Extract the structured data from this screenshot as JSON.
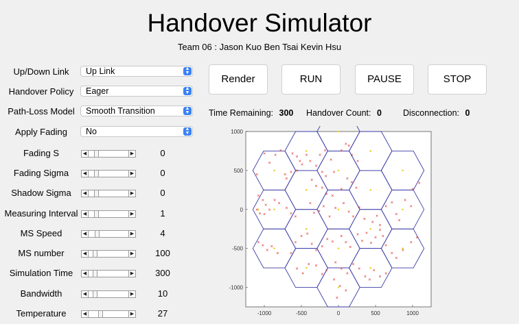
{
  "app": {
    "title": "Handover Simulator",
    "team": "Team 06 :  Jason Kuo  Ben Tsai  Kevin Hsu"
  },
  "controls": {
    "dropdowns": [
      {
        "label": "Up/Down Link",
        "value": "Up Link"
      },
      {
        "label": "Handover Policy",
        "value": "Eager"
      },
      {
        "label": "Path-Loss Model",
        "value": "Smooth Transition"
      },
      {
        "label": "Apply Fading",
        "value": "No"
      }
    ],
    "sliders": [
      {
        "label": "Fading S",
        "value": "0",
        "level": 0.15
      },
      {
        "label": "Fading Sigma",
        "value": "0",
        "level": 0.15
      },
      {
        "label": "Shadow Sigma",
        "value": "0",
        "level": 0.15
      },
      {
        "label": "Measuring Interval",
        "value": "1",
        "level": 0.15
      },
      {
        "label": "MS Speed",
        "value": "4",
        "level": 0.18
      },
      {
        "label": "MS number",
        "value": "100",
        "level": 0.12
      },
      {
        "label": "Simulation Time",
        "value": "300",
        "level": 0.12
      },
      {
        "label": "Bandwidth",
        "value": "10",
        "level": 0.12
      },
      {
        "label": "Temperature",
        "value": "27",
        "level": 0.28
      }
    ]
  },
  "buttons": {
    "render": "Render",
    "run": "RUN",
    "pause": "PAUSE",
    "stop": "STOP"
  },
  "status": {
    "time_label": "Time Remaining:",
    "time_value": "300",
    "handover_label": "Handover Count:",
    "handover_value": "0",
    "disconnect_label": "Disconnection:",
    "disconnect_value": "0"
  },
  "chart_data": {
    "type": "scatter",
    "title": "",
    "xlabel": "",
    "ylabel": "",
    "xlim": [
      -1250,
      1250
    ],
    "ylim": [
      -1250,
      1000
    ],
    "xticks": [
      -1000,
      -500,
      0,
      500,
      1000
    ],
    "yticks": [
      1000,
      500,
      0,
      -500,
      -1000
    ],
    "hex_cells_centers": [
      [
        0,
        0
      ],
      [
        0,
        500
      ],
      [
        433,
        250
      ],
      [
        433,
        -250
      ],
      [
        0,
        -500
      ],
      [
        -433,
        -250
      ],
      [
        -433,
        250
      ],
      [
        0,
        1000
      ],
      [
        433,
        750
      ],
      [
        866,
        500
      ],
      [
        866,
        0
      ],
      [
        866,
        -500
      ],
      [
        433,
        -750
      ],
      [
        0,
        -1000
      ],
      [
        -433,
        -750
      ],
      [
        -866,
        -500
      ],
      [
        -866,
        0
      ],
      [
        -866,
        500
      ],
      [
        -433,
        750
      ]
    ],
    "hex_radius": 289,
    "series": [
      {
        "color": "#dd2222",
        "marker": "x",
        "points": [
          [
            -1100,
            450
          ],
          [
            -1000,
            720
          ],
          [
            -930,
            600
          ],
          [
            -850,
            700
          ],
          [
            -780,
            760
          ],
          [
            -620,
            720
          ],
          [
            -560,
            680
          ],
          [
            -520,
            620
          ],
          [
            -490,
            580
          ],
          [
            -430,
            700
          ],
          [
            -560,
            500
          ],
          [
            -640,
            480
          ],
          [
            -720,
            450
          ],
          [
            -700,
            400
          ],
          [
            -380,
            620
          ],
          [
            -300,
            560
          ],
          [
            -250,
            700
          ],
          [
            -180,
            760
          ],
          [
            -100,
            640
          ],
          [
            -60,
            480
          ],
          [
            40,
            760
          ],
          [
            100,
            840
          ],
          [
            140,
            820
          ],
          [
            180,
            700
          ],
          [
            260,
            620
          ],
          [
            -220,
            480
          ],
          [
            -170,
            430
          ],
          [
            -360,
            380
          ],
          [
            -300,
            300
          ],
          [
            -220,
            280
          ],
          [
            -160,
            200
          ],
          [
            -80,
            180
          ],
          [
            40,
            260
          ],
          [
            120,
            400
          ],
          [
            180,
            350
          ],
          [
            240,
            280
          ],
          [
            -1080,
            180
          ],
          [
            -1020,
            120
          ],
          [
            -980,
            60
          ],
          [
            -930,
            0
          ],
          [
            -1060,
            -50
          ],
          [
            -1100,
            0
          ],
          [
            -1000,
            -60
          ],
          [
            -860,
            120
          ],
          [
            -800,
            80
          ],
          [
            -700,
            20
          ],
          [
            -640,
            -50
          ],
          [
            -580,
            -90
          ],
          [
            -380,
            80
          ],
          [
            -330,
            -40
          ],
          [
            -260,
            -20
          ],
          [
            -200,
            40
          ],
          [
            -120,
            -90
          ],
          [
            -40,
            20
          ],
          [
            70,
            80
          ],
          [
            140,
            -30
          ],
          [
            200,
            -90
          ],
          [
            280,
            30
          ],
          [
            350,
            -120
          ],
          [
            460,
            -160
          ],
          [
            520,
            -80
          ],
          [
            560,
            -200
          ],
          [
            640,
            40
          ],
          [
            720,
            90
          ],
          [
            780,
            -60
          ],
          [
            820,
            -140
          ],
          [
            900,
            120
          ],
          [
            980,
            40
          ],
          [
            1000,
            260
          ],
          [
            1090,
            340
          ],
          [
            -1080,
            -420
          ],
          [
            -1020,
            -460
          ],
          [
            -960,
            -520
          ],
          [
            -900,
            -470
          ],
          [
            -820,
            -560
          ],
          [
            -640,
            -560
          ],
          [
            -580,
            -420
          ],
          [
            -500,
            -340
          ],
          [
            -420,
            -310
          ],
          [
            -360,
            -440
          ],
          [
            -300,
            -520
          ],
          [
            -220,
            -470
          ],
          [
            -150,
            -380
          ],
          [
            -80,
            -410
          ],
          [
            40,
            -340
          ],
          [
            100,
            -420
          ],
          [
            160,
            -480
          ],
          [
            260,
            -320
          ],
          [
            320,
            -400
          ],
          [
            380,
            -300
          ],
          [
            440,
            -430
          ],
          [
            500,
            -360
          ],
          [
            560,
            -260
          ],
          [
            600,
            -340
          ],
          [
            640,
            -460
          ],
          [
            720,
            -560
          ],
          [
            780,
            -620
          ],
          [
            870,
            -520
          ],
          [
            980,
            -420
          ],
          [
            1060,
            -360
          ],
          [
            -560,
            -760
          ],
          [
            -480,
            -820
          ],
          [
            -400,
            -700
          ],
          [
            -300,
            -720
          ],
          [
            -220,
            -830
          ],
          [
            -160,
            -780
          ],
          [
            -40,
            -680
          ],
          [
            40,
            -760
          ],
          [
            120,
            -820
          ],
          [
            200,
            -700
          ],
          [
            280,
            -760
          ],
          [
            360,
            -860
          ],
          [
            420,
            -900
          ],
          [
            480,
            -780
          ],
          [
            560,
            -860
          ],
          [
            640,
            -820
          ],
          [
            -60,
            -900
          ],
          [
            20,
            -980
          ],
          [
            100,
            -1040
          ],
          [
            -20,
            -1130
          ]
        ]
      },
      {
        "color": "#e6d43a",
        "marker": "dot",
        "points": [
          [
            0,
            1000
          ],
          [
            -433,
            750
          ],
          [
            433,
            750
          ],
          [
            -866,
            500
          ],
          [
            0,
            500
          ],
          [
            866,
            500
          ],
          [
            -433,
            250
          ],
          [
            433,
            250
          ],
          [
            -866,
            0
          ],
          [
            0,
            0
          ],
          [
            866,
            0
          ],
          [
            -433,
            -250
          ],
          [
            433,
            -250
          ],
          [
            -866,
            -500
          ],
          [
            0,
            -500
          ],
          [
            866,
            -500
          ],
          [
            -433,
            -750
          ],
          [
            433,
            -750
          ],
          [
            0,
            -1000
          ],
          [
            -1080,
            0
          ]
        ]
      }
    ]
  }
}
